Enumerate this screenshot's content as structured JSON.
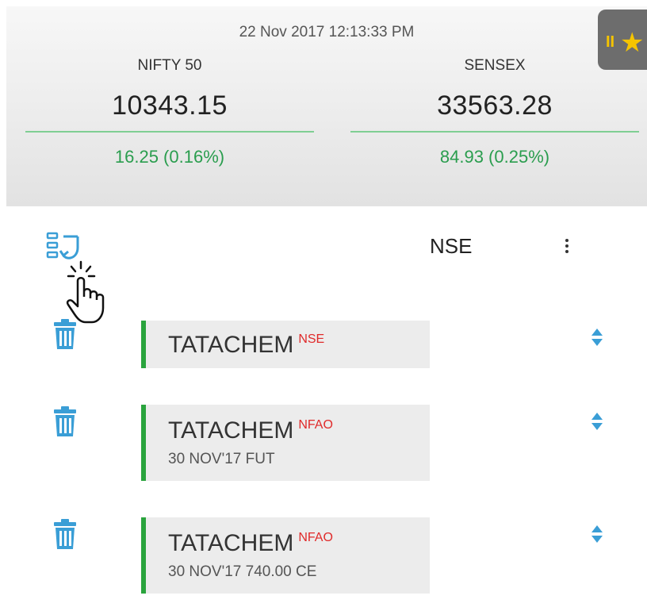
{
  "header": {
    "timestamp": "22 Nov 2017 12:13:33 PM",
    "indices": [
      {
        "name": "NIFTY 50",
        "value": "10343.15",
        "change": "16.25 (0.16%)"
      },
      {
        "name": "SENSEX",
        "value": "33563.28",
        "change": "84.93 (0.25%)"
      }
    ],
    "favorite_tab_icons": [
      "pause-icon",
      "star-icon"
    ]
  },
  "toolbar": {
    "exchange": "NSE",
    "icons": [
      "reorder-list-icon",
      "more-vert-icon",
      "hand-pointer-icon"
    ]
  },
  "watchlist": [
    {
      "symbol": "TATACHEM",
      "exchange": "NSE",
      "detail": ""
    },
    {
      "symbol": "TATACHEM",
      "exchange": "NFAO",
      "detail": "30 NOV'17 FUT"
    },
    {
      "symbol": "TATACHEM",
      "exchange": "NFAO",
      "detail": "30 NOV'17 740.00 CE"
    }
  ],
  "colors": {
    "accent_blue": "#3a9ed6",
    "positive_green": "#2a9d4e",
    "exchange_red": "#e02a2a",
    "row_bar_green": "#2aa43d",
    "star_yellow": "#f5c400"
  }
}
